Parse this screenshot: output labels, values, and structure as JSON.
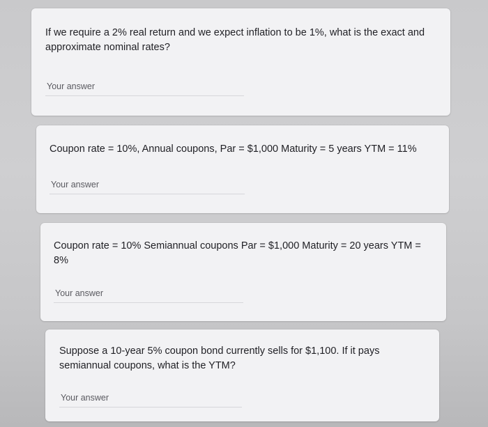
{
  "questions": [
    {
      "text": "If we require a 2% real return and we expect inflation to be 1%, what is the exact and approximate nominal rates?",
      "answer_placeholder": "Your answer",
      "answer_value": ""
    },
    {
      "text": "Coupon rate = 10%, Annual coupons, Par = $1,000 Maturity = 5 years YTM = 11%",
      "answer_placeholder": "Your answer",
      "answer_value": ""
    },
    {
      "text": "Coupon rate = 10% Semiannual coupons Par = $1,000 Maturity = 20 years YTM = 8%",
      "answer_placeholder": "Your answer",
      "answer_value": ""
    },
    {
      "text": "Suppose a 10-year 5% coupon bond currently sells for $1,100. If it pays semiannual coupons, what is the YTM?",
      "answer_placeholder": "Your answer",
      "answer_value": ""
    }
  ]
}
